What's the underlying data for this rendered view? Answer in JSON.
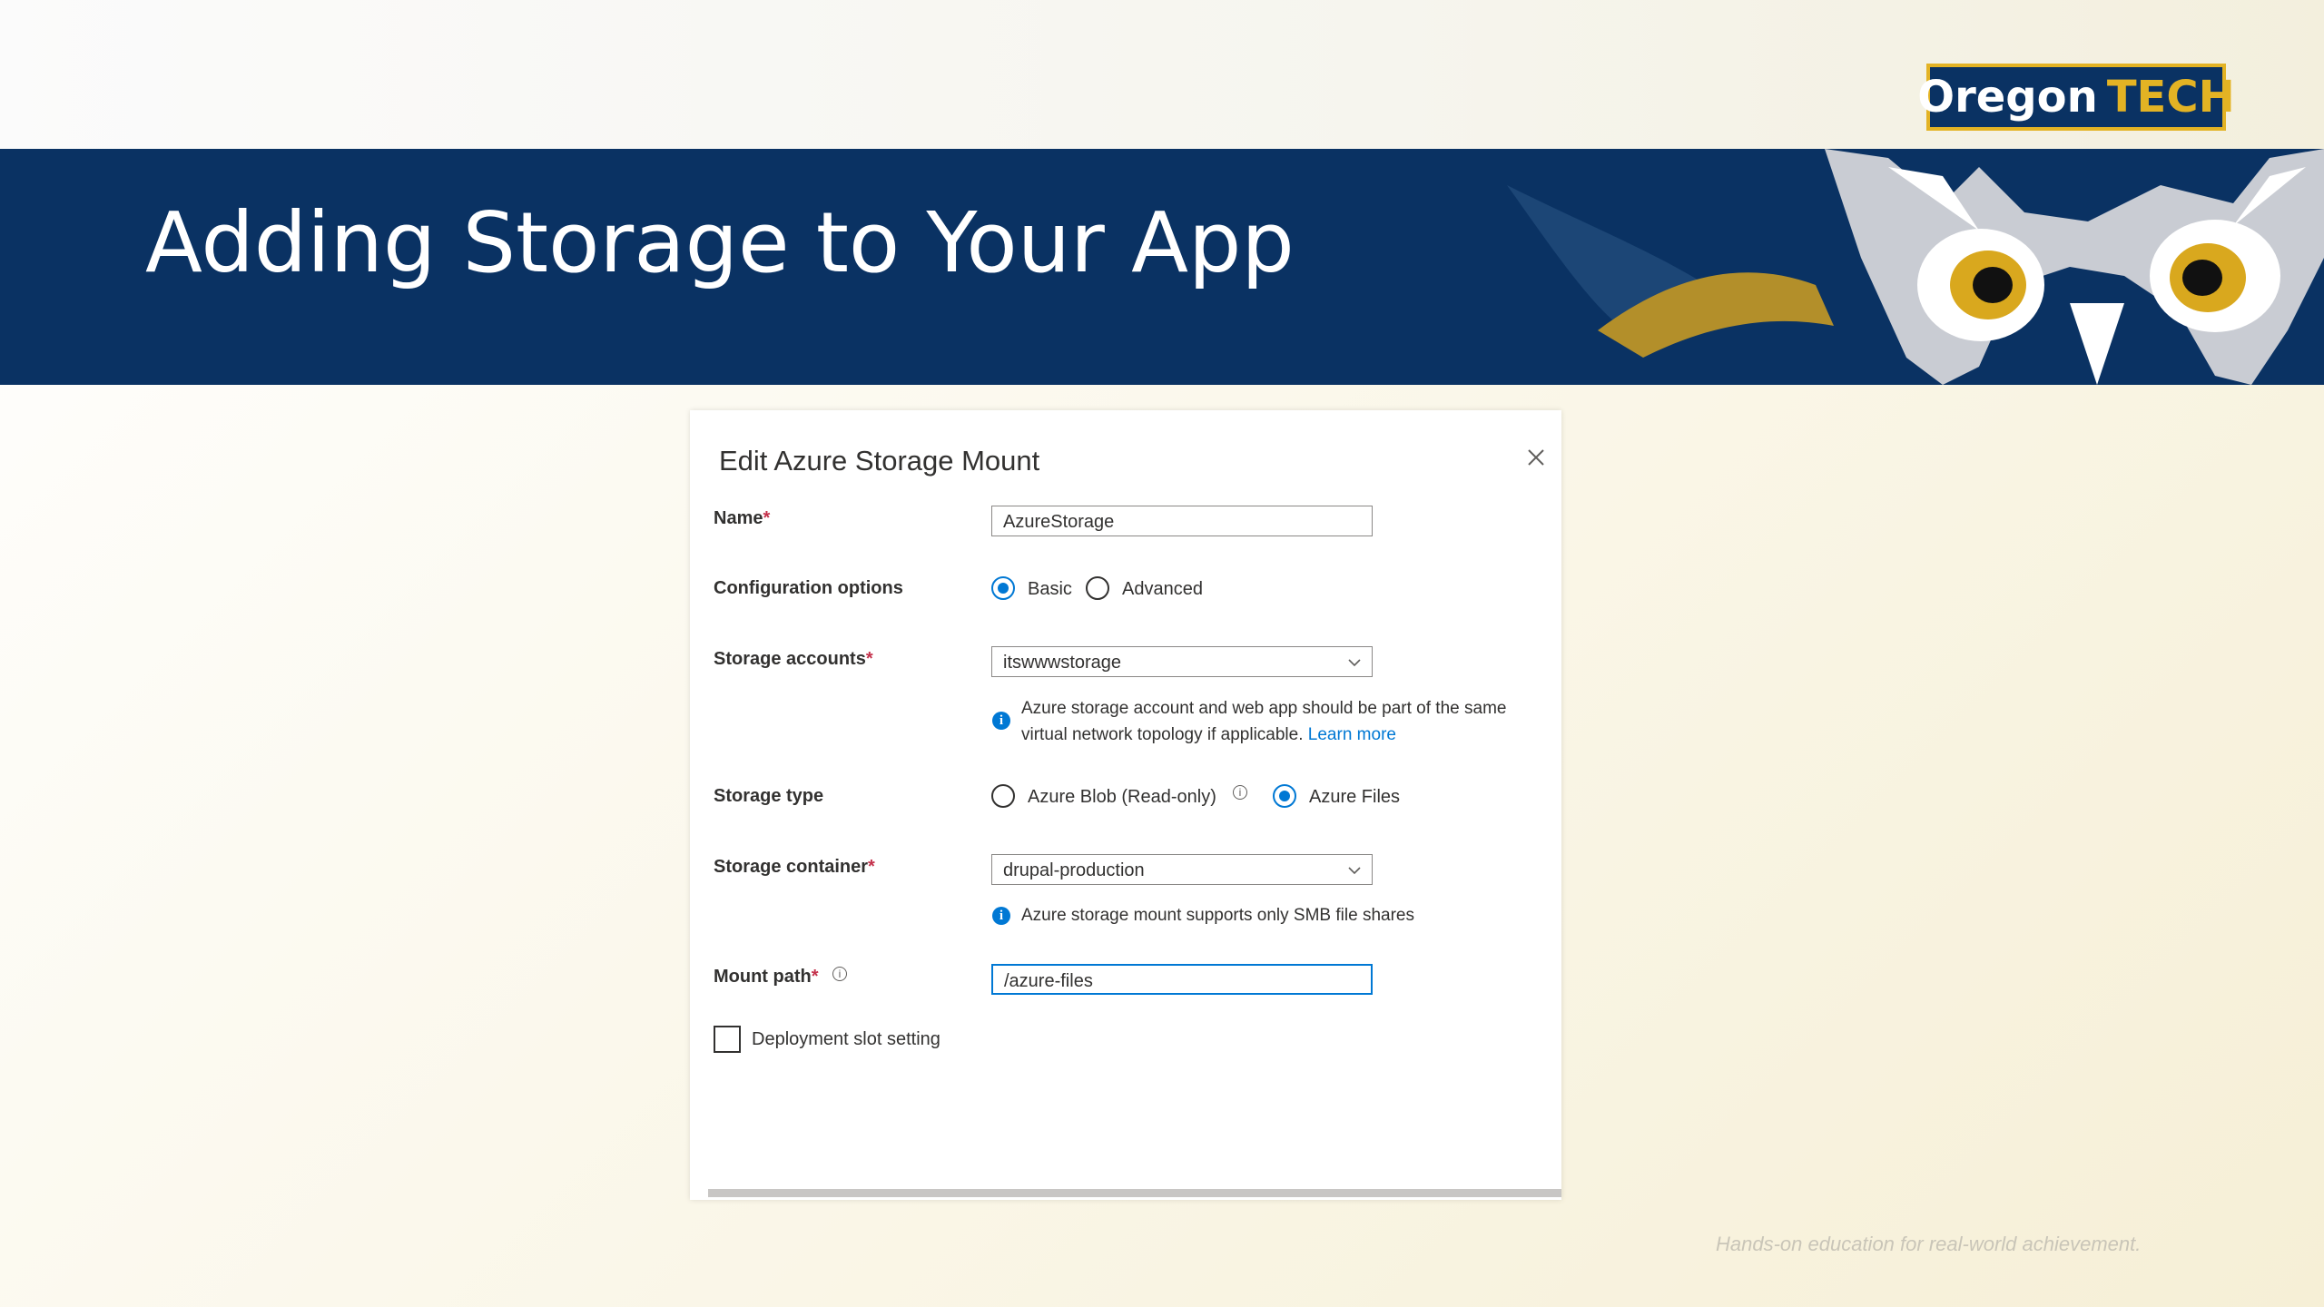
{
  "slide": {
    "title": "Adding Storage to Your App",
    "logo": {
      "text_primary": "Oregon",
      "text_secondary": "TECH"
    },
    "tagline": "Hands-on education for real-world achievement."
  },
  "dialog": {
    "title": "Edit Azure Storage Mount",
    "required_marker": "*",
    "name": {
      "label": "Name",
      "value": "AzureStorage"
    },
    "configuration_options": {
      "label": "Configuration options",
      "options": [
        "Basic",
        "Advanced"
      ],
      "selected": "Basic"
    },
    "storage_accounts": {
      "label": "Storage accounts",
      "value": "itswwwstorage",
      "note_line1": "Azure storage account and web app should be part of the same",
      "note_line2": "virtual network topology if applicable.",
      "note_link": "Learn more"
    },
    "storage_type": {
      "label": "Storage type",
      "options": [
        "Azure Blob (Read-only)",
        "Azure Files"
      ],
      "selected": "Azure Files"
    },
    "storage_container": {
      "label": "Storage container",
      "value": "drupal-production",
      "note": "Azure storage mount supports only SMB file shares"
    },
    "mount_path": {
      "label": "Mount path",
      "value": "/azure-files"
    },
    "deployment_slot": {
      "label": "Deployment slot setting",
      "checked": false
    }
  },
  "colors": {
    "navy": "#0a3263",
    "gold": "#e3b324",
    "azure_blue": "#0078d4"
  }
}
